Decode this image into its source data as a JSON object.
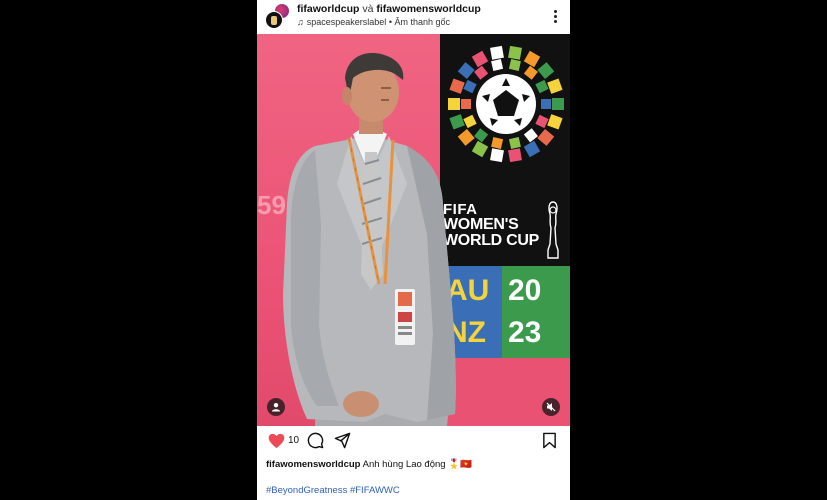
{
  "header": {
    "account1": "fifaworldcup",
    "joiner": "và",
    "account2": "fifawomensworldcup",
    "audio_artist": "spacespeakerslabel",
    "audio_sep": "•",
    "audio_label": "Âm thanh gốc"
  },
  "media": {
    "board_title_1": "FIFA",
    "board_title_2": "WOMEN'S",
    "board_title_3": "WORLD CUP",
    "board_code_a": "AU",
    "board_code_b": "NZ",
    "board_year_a": "20",
    "board_year_b": "23",
    "bg_number": "59"
  },
  "actions": {
    "like_count": "10"
  },
  "caption": {
    "username": "fifawomensworldcup",
    "text": "Anh hùng Lao động 🎖️🇻🇳",
    "hashtags": "#BeyondGreatness #FIFAWWC"
  },
  "icons": [
    "more-options-icon",
    "music-note-icon",
    "tag-people-icon",
    "mute-icon",
    "heart-icon",
    "comment-icon",
    "share-icon",
    "bookmark-icon"
  ],
  "colors": {
    "like_red": "#ed4956",
    "hashtag_blue": "#2f5fbd",
    "backdrop_pink": "#ec5577"
  }
}
